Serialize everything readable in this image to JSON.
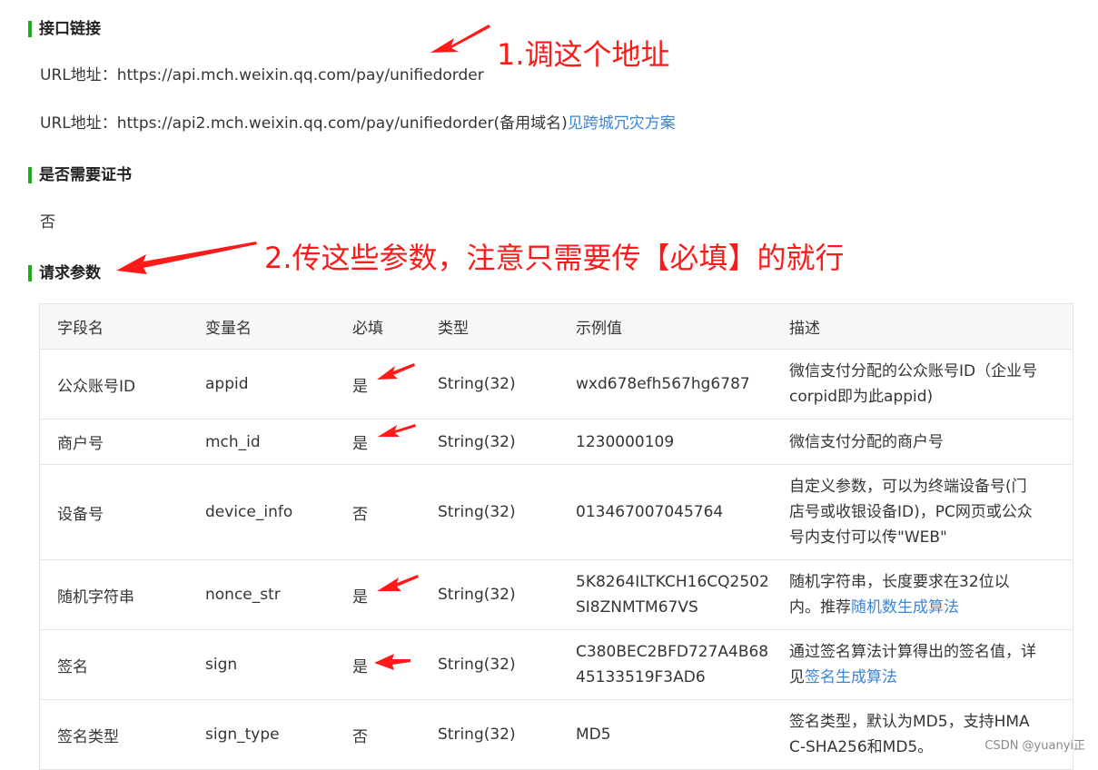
{
  "sections": {
    "api_link": "接口链接",
    "cert": "是否需要证书",
    "params": "请求参数"
  },
  "urls": {
    "label": "URL地址：",
    "primary": "https://api.mch.weixin.qq.com/pay/unifiedorder",
    "backup": "https://api2.mch.weixin.qq.com/pay/unifiedorder(备用域名)",
    "backup_link": "见跨城冗灾方案"
  },
  "cert_value": "否",
  "annotations": {
    "first": "1.调这个地址",
    "second": "2.传这些参数，注意只需要传【必填】的就行"
  },
  "table": {
    "headers": [
      "字段名",
      "变量名",
      "必填",
      "类型",
      "示例值",
      "描述"
    ],
    "rows": [
      {
        "field": "公众账号ID",
        "var": "appid",
        "required": "是",
        "type": "String(32)",
        "example": "wxd678efh567hg6787",
        "desc": "微信支付分配的公众账号ID（企业号corpid即为此appid)"
      },
      {
        "field": "商户号",
        "var": "mch_id",
        "required": "是",
        "type": "String(32)",
        "example": "1230000109",
        "desc": "微信支付分配的商户号"
      },
      {
        "field": "设备号",
        "var": "device_info",
        "required": "否",
        "type": "String(32)",
        "example": "013467007045764",
        "desc": "自定义参数，可以为终端设备号(门店号或收银设备ID)，PC网页或公众号内支付可以传\"WEB\""
      },
      {
        "field": "随机字符串",
        "var": "nonce_str",
        "required": "是",
        "type": "String(32)",
        "example": "5K8264ILTKCH16CQ2502SI8ZNMTM67VS",
        "desc": "随机字符串，长度要求在32位以内。推荐",
        "desc_link": "随机数生成算法"
      },
      {
        "field": "签名",
        "var": "sign",
        "required": "是",
        "type": "String(32)",
        "example": "C380BEC2BFD727A4B6845133519F3AD6",
        "desc": "通过签名算法计算得出的签名值，详见",
        "desc_link": "签名生成算法"
      },
      {
        "field": "签名类型",
        "var": "sign_type",
        "required": "否",
        "type": "String(32)",
        "example": "MD5",
        "desc": "签名类型，默认为MD5，支持HMAC-SHA256和MD5。"
      }
    ]
  },
  "watermark": "CSDN @yuanyi正",
  "colors": {
    "accent": "#1aad19",
    "annotation": "#ff1a1a",
    "link": "#3a86d8"
  }
}
